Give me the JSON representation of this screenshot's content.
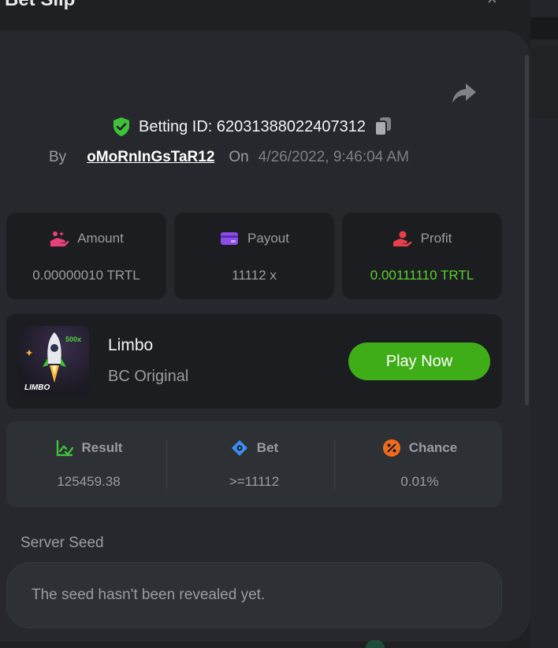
{
  "modal": {
    "title": "Bet Slip",
    "close_symbol": "×",
    "share_icon": "share-arrow-icon"
  },
  "betting": {
    "id_label": "Betting ID: 62031388022407312",
    "by_label": "By",
    "username": "oMoRnInGsTaR12",
    "on_label": "On",
    "date": "4/26/2022, 9:46:04 AM"
  },
  "stats": {
    "amount": {
      "label": "Amount",
      "value": "0.00000010 TRTL",
      "icon": "hand-money-icon"
    },
    "payout": {
      "label": "Payout",
      "value": "11112 x",
      "icon": "wallet-card-icon"
    },
    "profit": {
      "label": "Profit",
      "value": "0.00111110 TRTL",
      "icon": "hand-coin-icon"
    }
  },
  "game": {
    "name": "Limbo",
    "subtitle": "BC Original",
    "thumb_label": "LIMBO",
    "thumb_badge": "500x",
    "play_label": "Play Now"
  },
  "result": {
    "result": {
      "label": "Result",
      "value": "125459.38"
    },
    "bet": {
      "label": "Bet",
      "value": ">=11112"
    },
    "chance": {
      "label": "Chance",
      "value": "0.01%"
    }
  },
  "seed": {
    "label": "Server Seed",
    "text": "The seed hasn't been revealed yet."
  },
  "colors": {
    "accent_green": "#3fad18",
    "profit_green": "#5ad12c",
    "shield_green": "#3fc23a",
    "amount_pink": "#e8407a",
    "payout_purple": "#8b4ce8",
    "profit_red": "#e8404a",
    "bet_blue": "#3b8ef0",
    "chance_orange": "#f26b1d"
  }
}
